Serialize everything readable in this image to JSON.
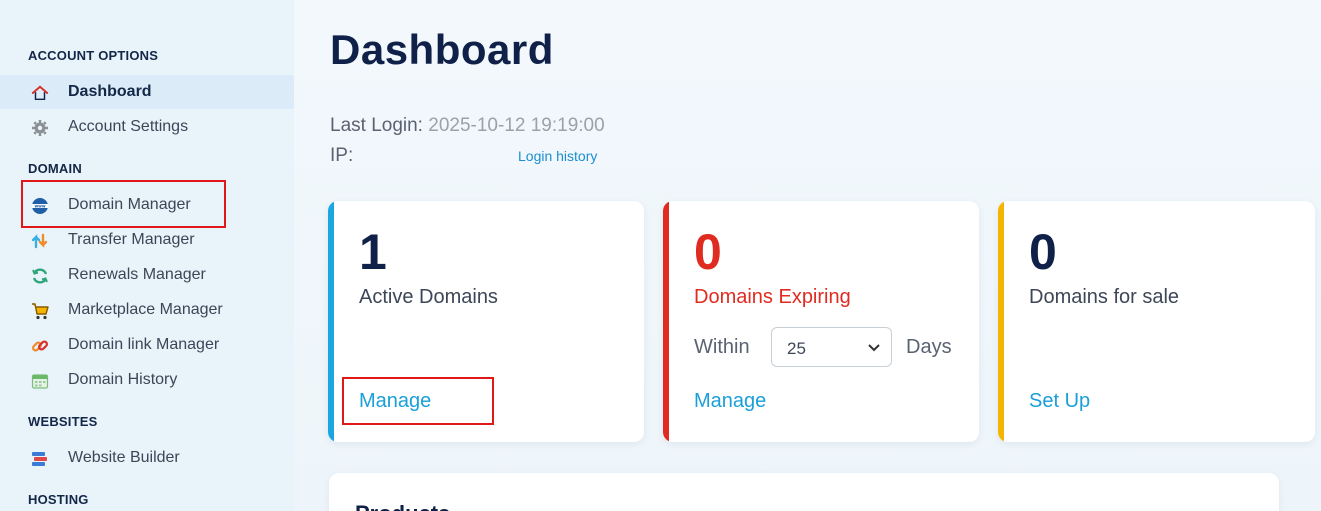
{
  "sidebar": {
    "sections": [
      {
        "heading": "ACCOUNT OPTIONS"
      },
      {
        "heading": "DOMAIN"
      },
      {
        "heading": "WEBSITES"
      },
      {
        "heading": "HOSTING"
      }
    ],
    "items": [
      {
        "label": "Dashboard",
        "icon": "home-icon",
        "active": true
      },
      {
        "label": "Account Settings",
        "icon": "gear-icon"
      },
      {
        "label": "Domain Manager",
        "icon": "www-globe-icon"
      },
      {
        "label": "Transfer Manager",
        "icon": "transfer-arrows-icon"
      },
      {
        "label": "Renewals Manager",
        "icon": "renew-icon"
      },
      {
        "label": "Marketplace Manager",
        "icon": "cart-icon"
      },
      {
        "label": "Domain link Manager",
        "icon": "link-icon"
      },
      {
        "label": "Domain History",
        "icon": "calendar-icon"
      },
      {
        "label": "Website Builder",
        "icon": "website-builder-icon"
      }
    ]
  },
  "main": {
    "title": "Dashboard",
    "last_login_label": "Last Login:",
    "last_login_value": "2025-10-12 19:19:00",
    "ip_label": "IP:",
    "login_history_link": "Login history",
    "cards": [
      {
        "count": "1",
        "title": "Active Domains",
        "link": "Manage",
        "accent": "#1ba6e0"
      },
      {
        "count": "0",
        "title": "Domains Expiring",
        "link": "Manage",
        "accent": "#e02b20",
        "within_label": "Within",
        "days_label": "Days",
        "select_value": "25"
      },
      {
        "count": "0",
        "title": "Domains for sale",
        "link": "Set Up",
        "accent": "#f5b400"
      }
    ],
    "products_title": "Products"
  },
  "colors": {
    "navy": "#0f2148",
    "link_blue": "#1a9fd8",
    "expiring_red": "#e02b20",
    "annotation_red": "#e01818"
  }
}
